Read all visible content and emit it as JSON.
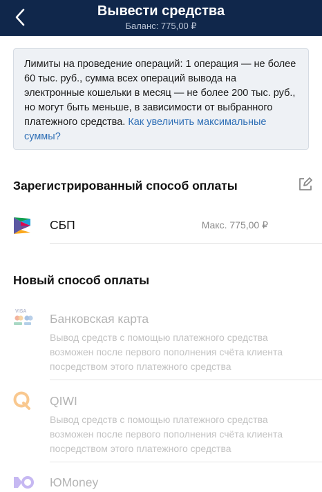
{
  "header": {
    "title": "Вывести средства",
    "balance": "Баланс: 775,00 ₽"
  },
  "info": {
    "text": "Лимиты на проведение операций: 1 операция — не более 60 тыс. руб., сумма всех операций вывода на электронные кошельки в месяц — не более 200 тыс. руб., но могут быть меньше, в зависимости от выбранного платежного средства. ",
    "link": "Как увеличить максимальные суммы?"
  },
  "registered": {
    "title": "Зарегистрированный способ оплаты",
    "method": {
      "name": "СБП",
      "max": "Макс. 775,00 ₽",
      "icon": "sbp-icon"
    }
  },
  "new_methods": {
    "title": "Новый способ оплаты",
    "items": [
      {
        "name": "Банковская карта",
        "description": "Вывод средств с помощью платежного средства возможен после первого пополнения счёта клиента посредством этого платежного средства",
        "icon": "bank-card-icon",
        "icon_text": "VISA"
      },
      {
        "name": "QIWI",
        "description": "Вывод средств с помощью платежного средства возможен после первого пополнения счёта клиента посредством этого платежного средства",
        "icon": "qiwi-icon"
      },
      {
        "name": "ЮMoney",
        "icon": "yumoney-icon"
      }
    ]
  },
  "colors": {
    "header_bg": "#10274b",
    "link": "#2f6fb6",
    "disabled_text": "#b4b4b4"
  }
}
